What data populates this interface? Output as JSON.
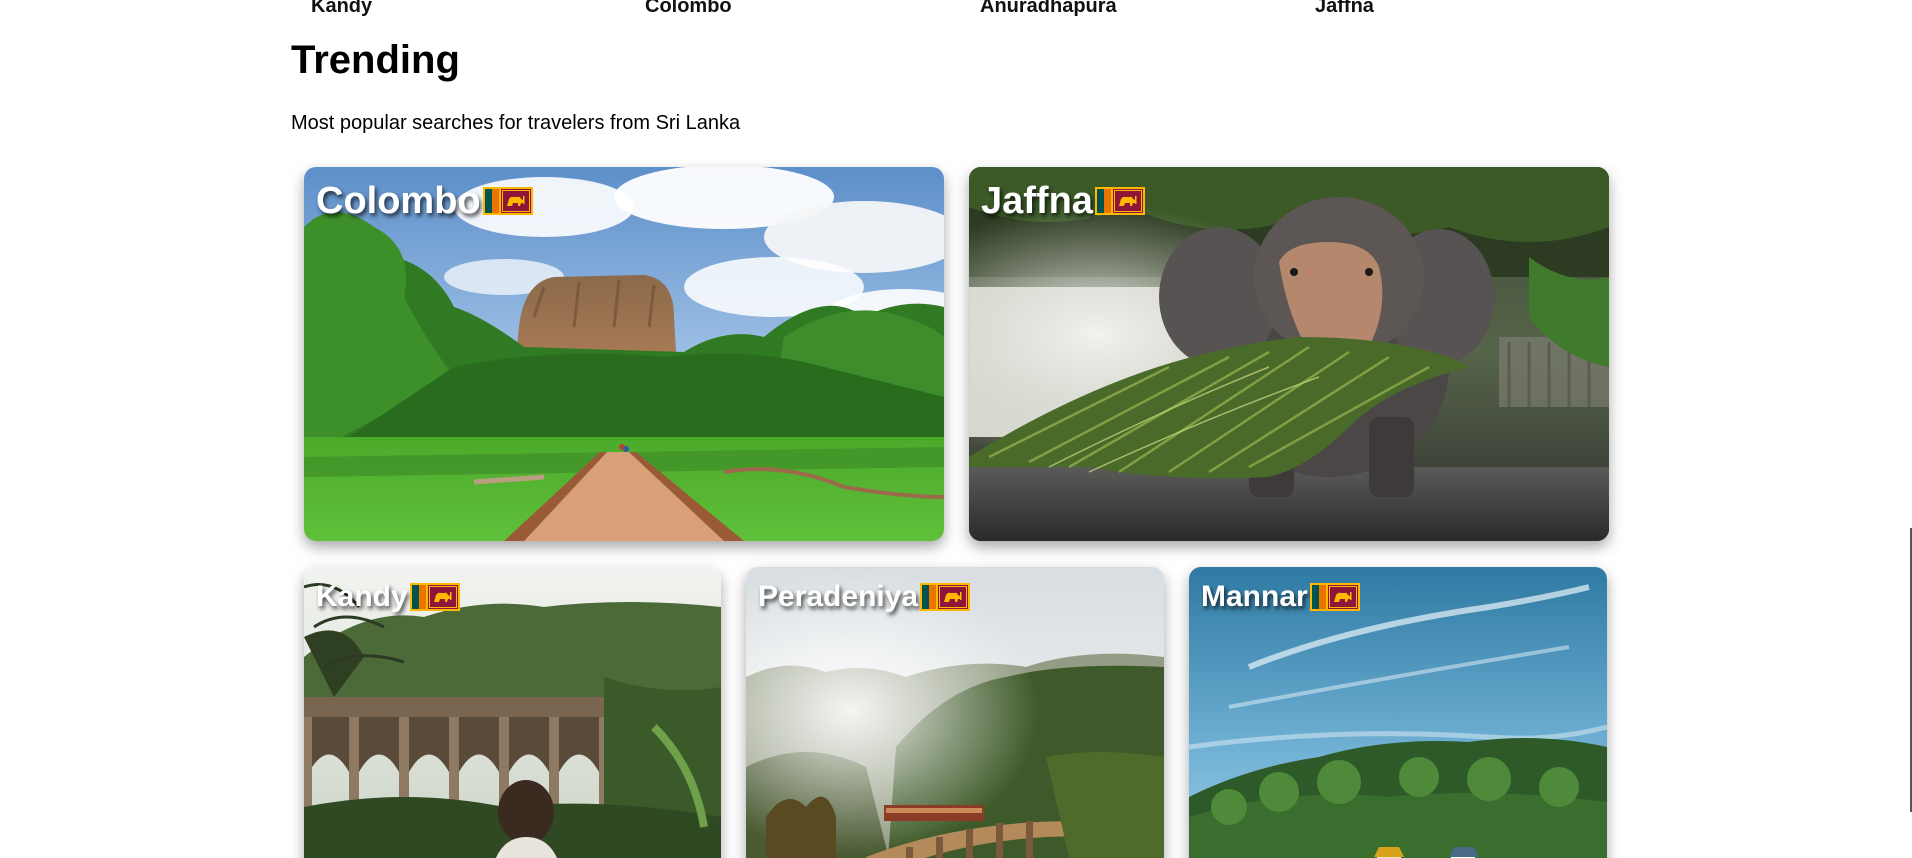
{
  "top_nav": {
    "items": [
      {
        "label": "Kandy"
      },
      {
        "label": "Colombo"
      },
      {
        "label": "Anuradhapura"
      },
      {
        "label": "Jaffna"
      }
    ]
  },
  "trending": {
    "title": "Trending",
    "subtitle": "Most popular searches for travelers from Sri Lanka",
    "cards": [
      {
        "city": "Colombo",
        "flag_icon": "sri-lanka-flag-icon",
        "image": "sigiriya-rock-garden"
      },
      {
        "city": "Jaffna",
        "flag_icon": "sri-lanka-flag-icon",
        "image": "elephant-eating-palm-leaves"
      },
      {
        "city": "Kandy",
        "flag_icon": "sri-lanka-flag-icon",
        "image": "nine-arch-bridge-jungle"
      },
      {
        "city": "Peradeniya",
        "flag_icon": "sri-lanka-flag-icon",
        "image": "train-on-bridge-hills"
      },
      {
        "city": "Mannar",
        "flag_icon": "sri-lanka-flag-icon",
        "image": "blue-sky-forested-hill-town"
      }
    ]
  },
  "colors": {
    "flag_maroon": "#8d153a",
    "flag_gold": "#ffb700",
    "flag_green": "#00534e",
    "flag_orange": "#eb7400",
    "card_title_text": "#ffffff"
  }
}
